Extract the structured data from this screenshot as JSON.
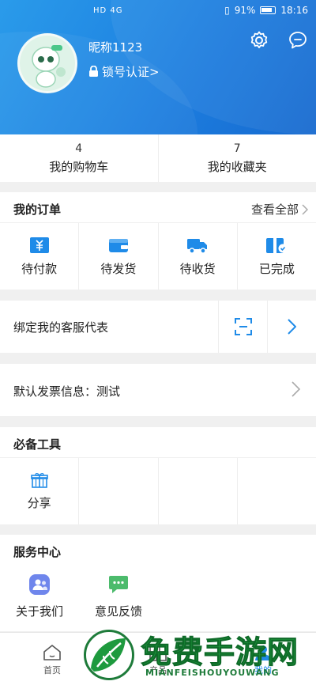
{
  "status_bar": {
    "left_indicators": "HD 4G",
    "battery_percent": "91%",
    "time": "18:16"
  },
  "profile": {
    "nickname": "昵称1123",
    "lock_label": "锁号认证>"
  },
  "counts": [
    {
      "num": "4",
      "label": "我的购物车"
    },
    {
      "num": "7",
      "label": "我的收藏夹"
    }
  ],
  "orders": {
    "title": "我的订单",
    "view_all": "查看全部",
    "items": [
      {
        "label": "待付款",
        "icon": "payment-icon"
      },
      {
        "label": "待发货",
        "icon": "wallet-icon"
      },
      {
        "label": "待收货",
        "icon": "truck-icon"
      },
      {
        "label": "已完成",
        "icon": "gift-check-icon"
      }
    ]
  },
  "bind": {
    "label": "绑定我的客服代表"
  },
  "invoice": {
    "label": "默认发票信息：测试"
  },
  "tools": {
    "title": "必备工具",
    "items": [
      {
        "label": "分享",
        "icon": "gift-icon"
      }
    ]
  },
  "service": {
    "title": "服务中心",
    "items": [
      {
        "label": "关于我们",
        "icon": "contacts-icon"
      },
      {
        "label": "意见反馈",
        "icon": "chat-icon"
      }
    ]
  },
  "bottom_nav": [
    {
      "label": "首页",
      "icon": "home-icon"
    },
    {
      "label": "产品",
      "icon": "grid-icon"
    },
    {
      "label": "我的",
      "icon": "user-icon"
    }
  ],
  "watermark": {
    "title": "免费手游网",
    "subtitle": "MIANFEISHOUYOUWANG"
  },
  "colors": {
    "header_blue": "#1d7fe0",
    "icon_blue": "#1f8be8",
    "watermark_green": "#1e9a3e"
  }
}
